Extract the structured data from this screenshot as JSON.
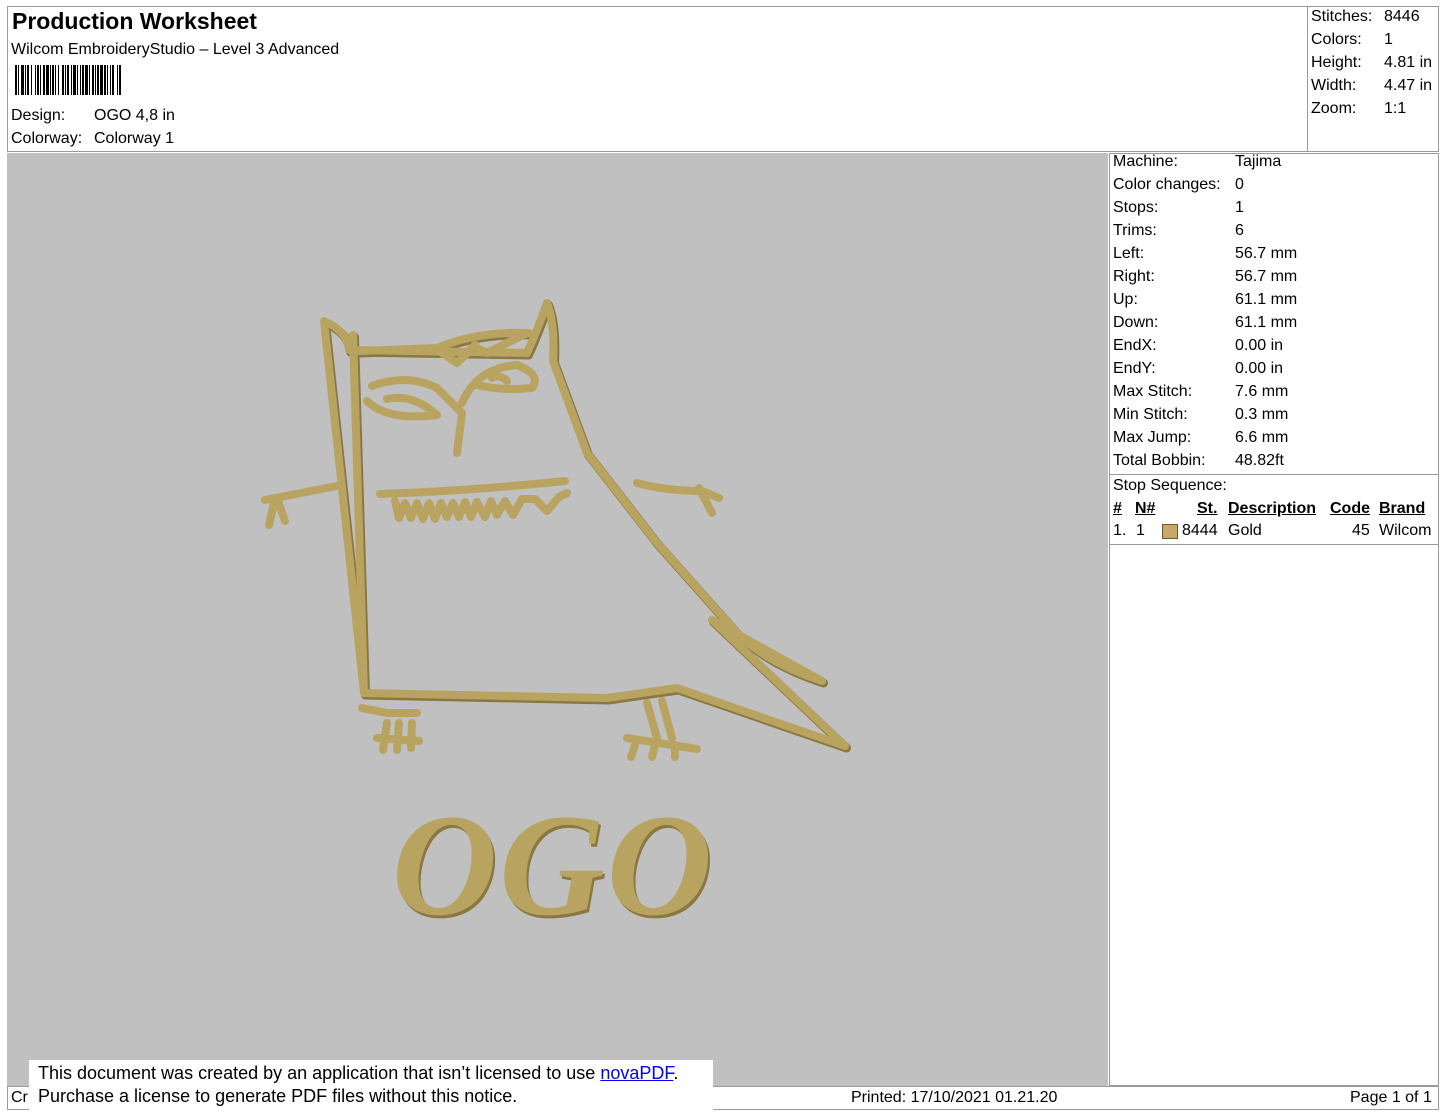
{
  "header": {
    "title": "Production Worksheet",
    "subtitle": "Wilcom EmbroideryStudio – Level 3 Advanced",
    "design_label": "Design:",
    "design_value": "OGO 4,8 in",
    "colorway_label": "Colorway:",
    "colorway_value": "Colorway 1"
  },
  "summary": [
    {
      "label": "Stitches:",
      "value": "8446"
    },
    {
      "label": "Colors:",
      "value": "1"
    },
    {
      "label": "Height:",
      "value": "4.81 in"
    },
    {
      "label": "Width:",
      "value": "4.47 in"
    },
    {
      "label": "Zoom:",
      "value": "1:1"
    }
  ],
  "machine": [
    {
      "label": "Machine:",
      "value": "Tajima"
    },
    {
      "label": "Color changes:",
      "value": "0"
    },
    {
      "label": "Stops:",
      "value": "1"
    },
    {
      "label": "Trims:",
      "value": "6"
    },
    {
      "label": "Left:",
      "value": "56.7 mm"
    },
    {
      "label": "Right:",
      "value": "56.7 mm"
    },
    {
      "label": "Up:",
      "value": "61.1 mm"
    },
    {
      "label": "Down:",
      "value": "61.1 mm"
    },
    {
      "label": "EndX:",
      "value": "0.00 in"
    },
    {
      "label": "EndY:",
      "value": "0.00 in"
    },
    {
      "label": "Max Stitch:",
      "value": "7.6 mm"
    },
    {
      "label": "Min Stitch:",
      "value": "0.3 mm"
    },
    {
      "label": "Max Jump:",
      "value": "6.6 mm"
    },
    {
      "label": "Total Bobbin:",
      "value": "48.82ft"
    }
  ],
  "stop_sequence": {
    "title": "Stop Sequence:",
    "columns": [
      "#",
      "N#",
      "St.",
      "Description",
      "Code",
      "Brand"
    ],
    "rows": [
      {
        "index": "1.",
        "n": "1",
        "st": "8444",
        "description": "Gold",
        "code": "45",
        "brand": "Wilcom",
        "color": "#c8a868"
      }
    ]
  },
  "design": {
    "text": "OGO",
    "thread_color": "#b8a460",
    "shadow_color": "#8a7840",
    "background_color": "#c0c0c0"
  },
  "notice": {
    "line1_prefix": "This document was created by an application that isn’t licensed to use ",
    "link": "novaPDF",
    "line1_suffix": ".",
    "line2": "Purchase a license to generate PDF files without this notice."
  },
  "footer": {
    "left_fragment": "Cr",
    "printed": "Printed: 17/10/2021 01.21.20",
    "page": "Page 1 of 1"
  }
}
